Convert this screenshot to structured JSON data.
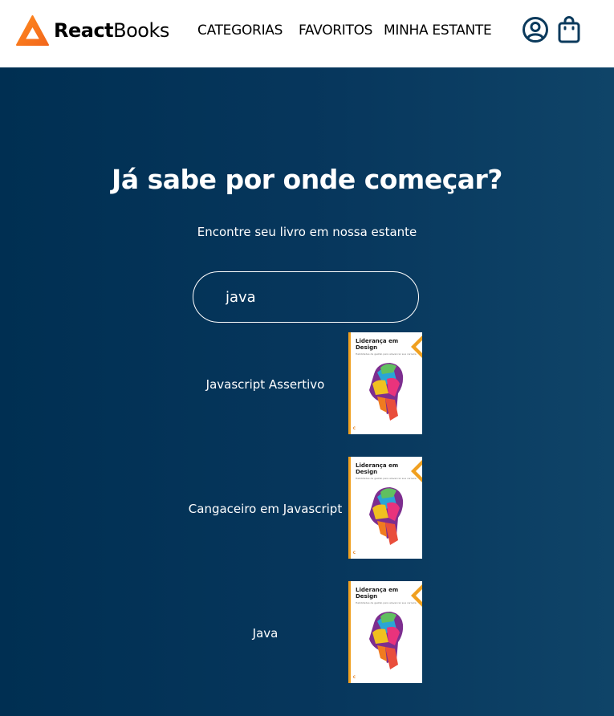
{
  "header": {
    "logo_bold": "React",
    "logo_light": "Books",
    "nav": [
      {
        "label": "CATEGORIAS"
      },
      {
        "label": "FAVORITOS"
      },
      {
        "label": "MINHA ESTANTE"
      }
    ],
    "icons": {
      "profile": "user-circle-icon",
      "bag": "shopping-bag-icon"
    }
  },
  "hero": {
    "title": "Já sabe por onde começar?",
    "subtitle": "Encontre seu livro em nossa estante",
    "search_value": "java"
  },
  "results": [
    {
      "title": "Javascript Assertivo",
      "cover_title_line1": "Liderança em",
      "cover_title_line2": "Design",
      "cover_subtitle": "Habilidades de gestão para alavancar sua carreira"
    },
    {
      "title": "Cangaceiro em Javascript",
      "cover_title_line1": "Liderança em",
      "cover_title_line2": "Design",
      "cover_subtitle": "Habilidades de gestão para alavancar sua carreira"
    },
    {
      "title": "Java",
      "cover_title_line1": "Liderança em",
      "cover_title_line2": "Design",
      "cover_subtitle": "Habilidades de gestão para alavancar sua carreira"
    }
  ],
  "colors": {
    "accent": "#f97316",
    "hero_bg": "#002f52",
    "cover_spine": "#f0a020",
    "icon": "#0b3a5c"
  }
}
